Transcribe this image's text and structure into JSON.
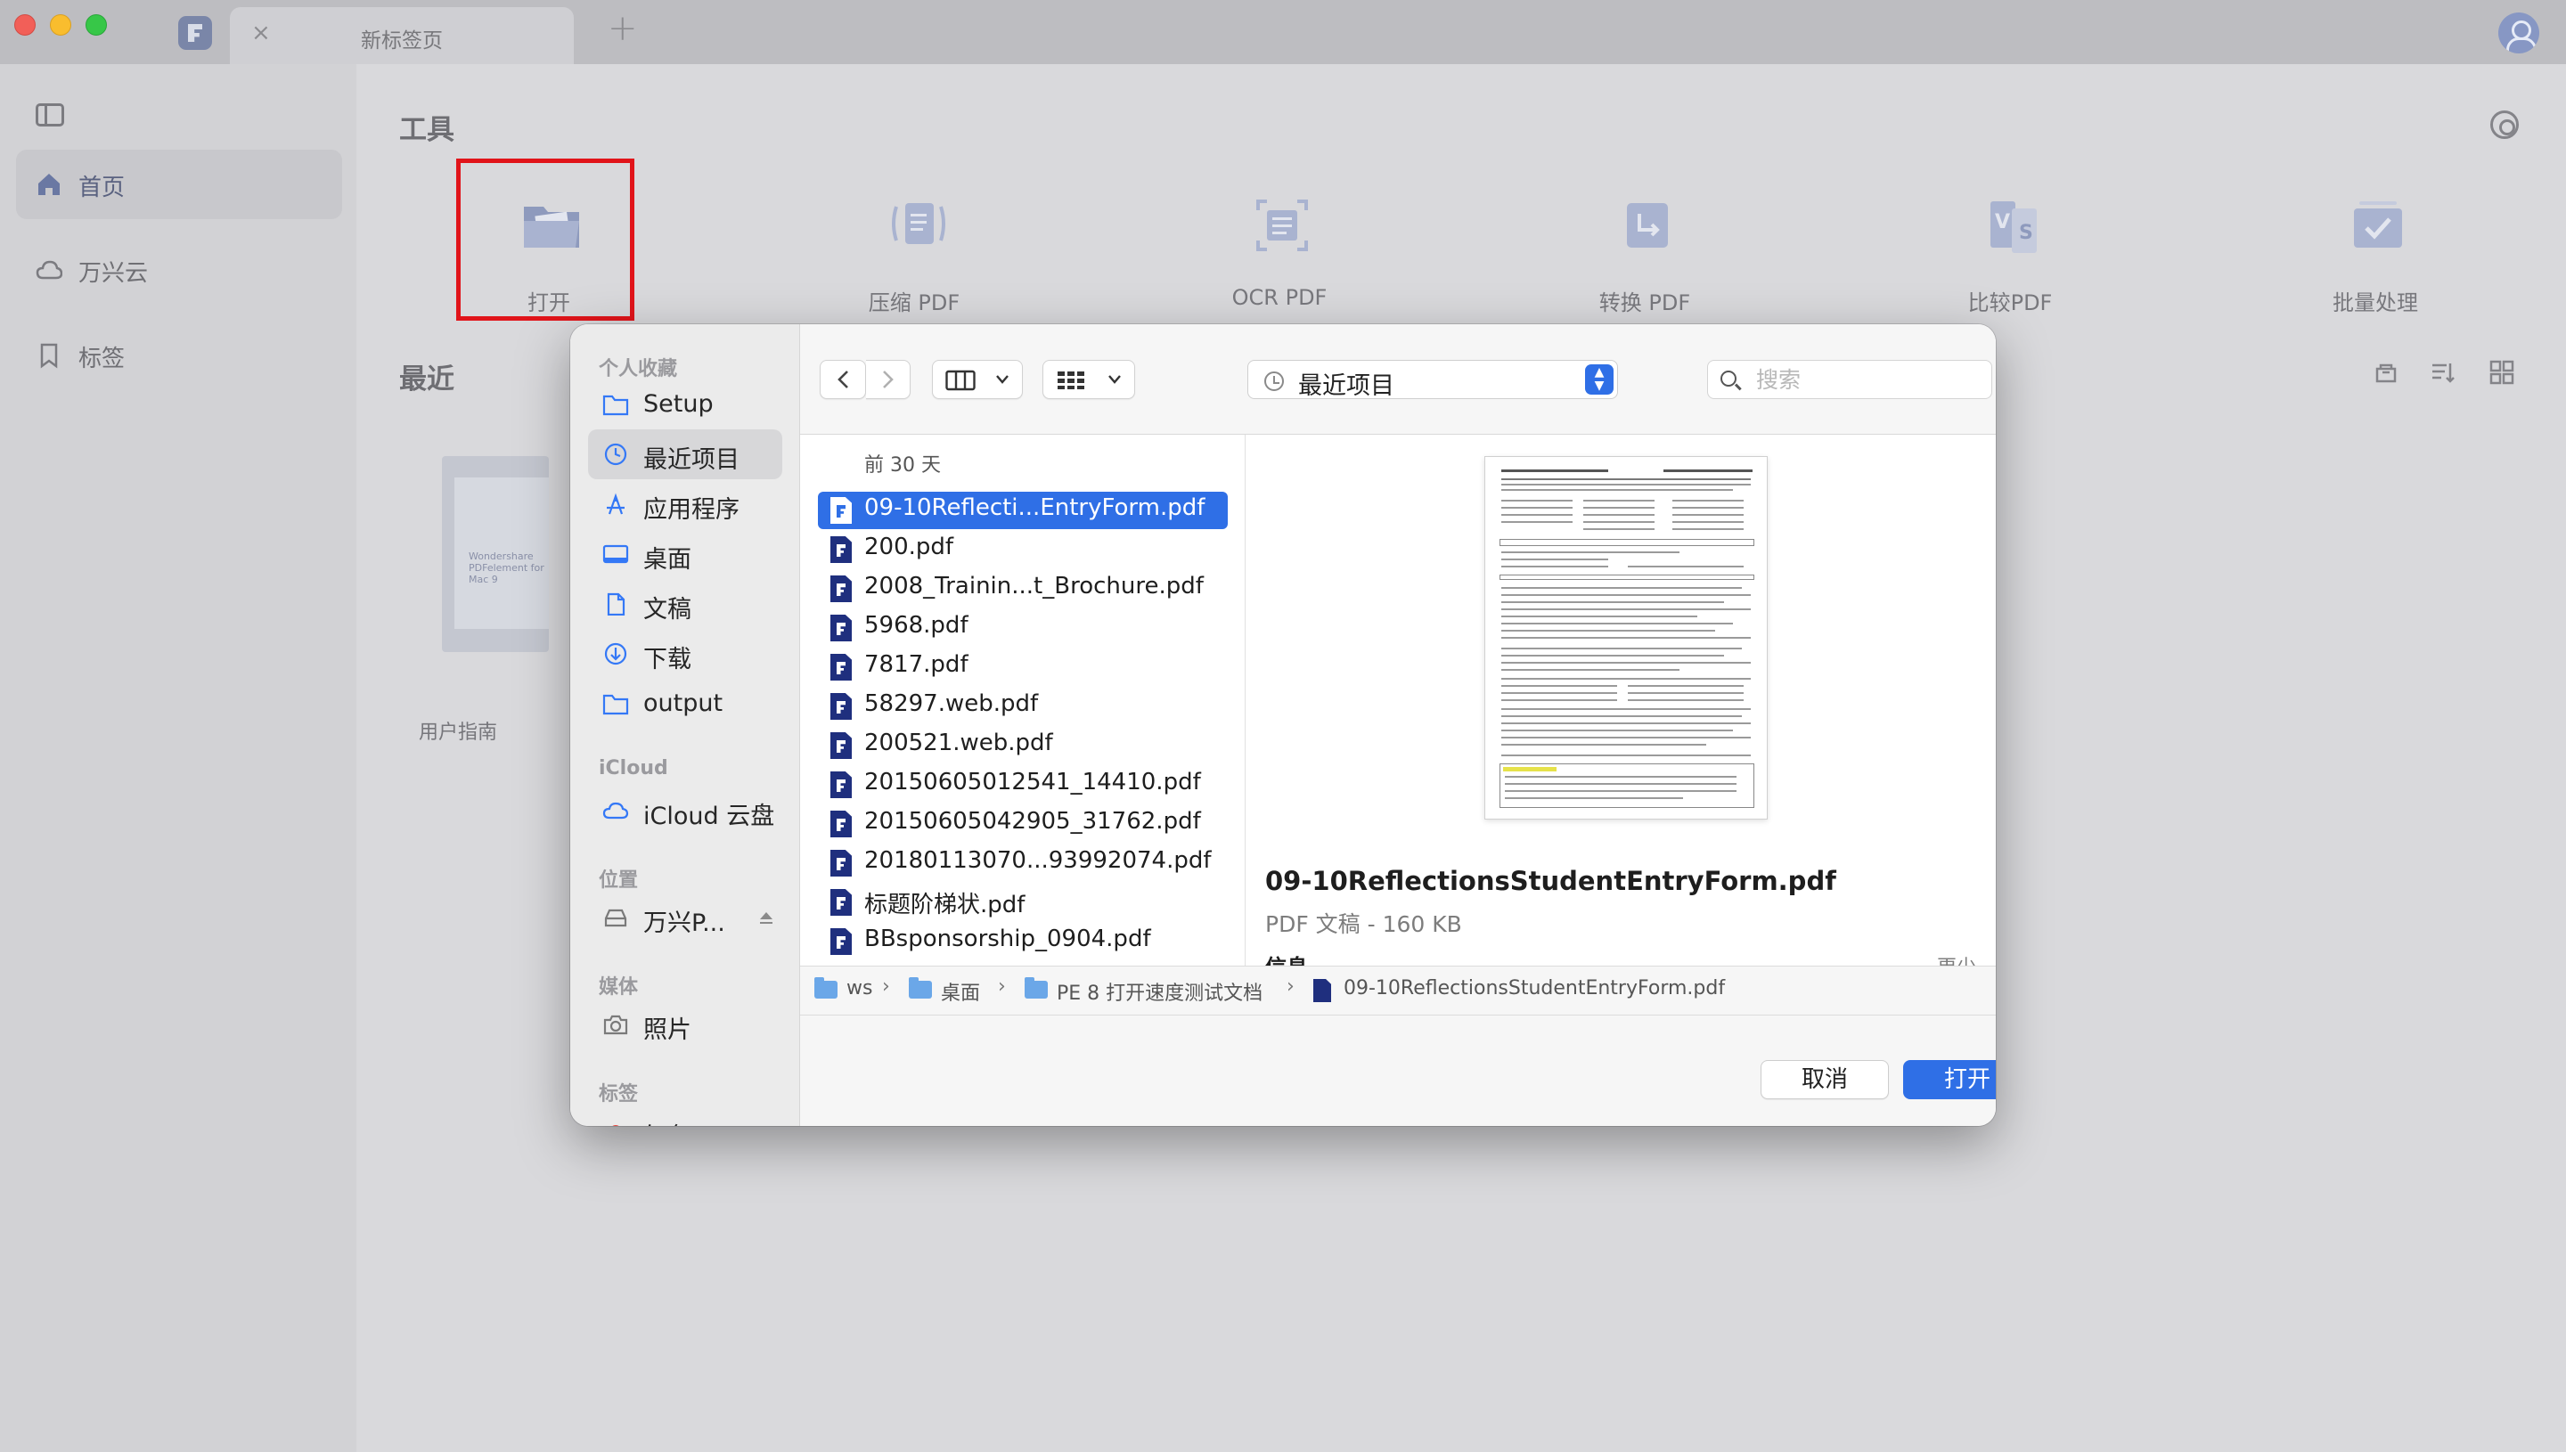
{
  "window": {
    "tab_title": "新标签页",
    "tab_close": "×",
    "new_tab": "+"
  },
  "sidebar": {
    "items": [
      {
        "label": "首页",
        "icon": "home-icon",
        "active": true
      },
      {
        "label": "万兴云",
        "icon": "cloud-icon",
        "active": false
      },
      {
        "label": "标签",
        "icon": "bookmark-icon",
        "active": false
      }
    ]
  },
  "main": {
    "tools_title": "工具",
    "recent_title": "最近",
    "tools": [
      {
        "label": "打开",
        "icon": "open-folder-icon"
      },
      {
        "label": "压缩 PDF",
        "icon": "compress-pdf-icon"
      },
      {
        "label": "OCR PDF",
        "icon": "ocr-pdf-icon"
      },
      {
        "label": "转换 PDF",
        "icon": "convert-pdf-icon"
      },
      {
        "label": "比较PDF",
        "icon": "compare-pdf-icon"
      },
      {
        "label": "批量处理",
        "icon": "batch-process-icon"
      }
    ],
    "recent_file": {
      "label": "用户指南",
      "thumb_text": "Wondershare PDFelement for Mac 9"
    }
  },
  "dialog": {
    "sidebar": {
      "sections": [
        {
          "header": "个人收藏",
          "items": [
            {
              "label": "Setup",
              "icon": "folder-icon"
            },
            {
              "label": "最近项目",
              "icon": "clock-icon",
              "active": true
            },
            {
              "label": "应用程序",
              "icon": "applications-icon"
            },
            {
              "label": "桌面",
              "icon": "desktop-icon"
            },
            {
              "label": "文稿",
              "icon": "document-icon"
            },
            {
              "label": "下载",
              "icon": "download-icon"
            },
            {
              "label": "output",
              "icon": "folder-icon"
            }
          ]
        },
        {
          "header": "iCloud",
          "items": [
            {
              "label": "iCloud 云盘",
              "icon": "icloud-icon"
            }
          ]
        },
        {
          "header": "位置",
          "items": [
            {
              "label": "万兴P...",
              "icon": "disk-icon"
            }
          ]
        },
        {
          "header": "媒体",
          "items": [
            {
              "label": "照片",
              "icon": "camera-icon"
            }
          ]
        },
        {
          "header": "标签",
          "items": [
            {
              "label": "红色",
              "icon": "tag-dot-icon"
            }
          ]
        }
      ]
    },
    "toolbar": {
      "location": "最近项目",
      "search_placeholder": "搜索",
      "back": "‹",
      "forward": "›"
    },
    "files": {
      "group_label": "前 30 天",
      "items": [
        "09-10Reflecti...EntryForm.pdf",
        "200.pdf",
        "2008_Trainin...t_Brochure.pdf",
        "5968.pdf",
        "7817.pdf",
        "58297.web.pdf",
        "200521.web.pdf",
        "20150605012541_14410.pdf",
        "20150605042905_31762.pdf",
        "20180113070...93992074.pdf",
        "标题阶梯状.pdf",
        "BBsponsorship_0904.pdf"
      ],
      "selected_index": 0
    },
    "preview": {
      "name": "09-10ReflectionsStudentEntryForm.pdf",
      "meta": "PDF 文稿 - 160 KB",
      "info_label": "信息",
      "less_label": "更少"
    },
    "path": {
      "crumbs": [
        "ws",
        "桌面",
        "PE 8 打开速度测试文档",
        "09-10ReflectionsStudentEntryForm.pdf"
      ]
    },
    "footer": {
      "cancel": "取消",
      "open": "打开"
    }
  },
  "colors": {
    "accent": "#2f6fe6",
    "highlight_box": "#e1141a",
    "pdf_icon": "#1f2f7e"
  }
}
